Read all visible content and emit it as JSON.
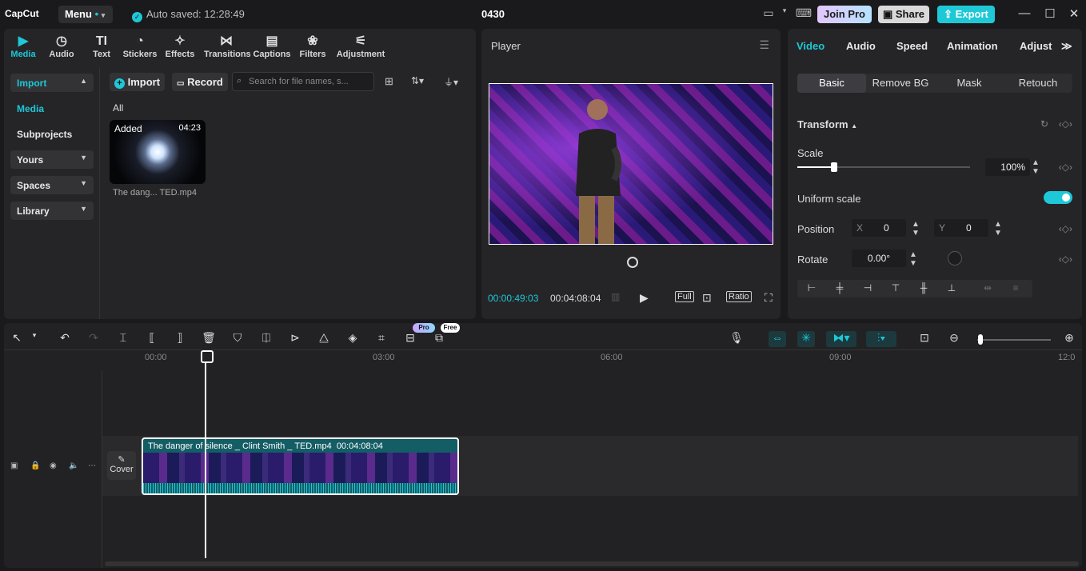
{
  "app": {
    "logo": "CapCut",
    "menu": "Menu",
    "autosave": "Auto saved: 12:28:49",
    "project_title": "0430"
  },
  "titlebar": {
    "join_pro": "Join Pro",
    "share": "Share",
    "export": "Export"
  },
  "toolbar": {
    "tabs": [
      {
        "label": "Media",
        "icon": "media-icon"
      },
      {
        "label": "Audio",
        "icon": "audio-icon"
      },
      {
        "label": "Text",
        "icon": "text-icon"
      },
      {
        "label": "Stickers",
        "icon": "stickers-icon"
      },
      {
        "label": "Effects",
        "icon": "effects-icon"
      },
      {
        "label": "Transitions",
        "icon": "transitions-icon"
      },
      {
        "label": "Captions",
        "icon": "captions-icon"
      },
      {
        "label": "Filters",
        "icon": "filters-icon"
      },
      {
        "label": "Adjustment",
        "icon": "adjustment-icon"
      }
    ],
    "active": "Media"
  },
  "sidebar": {
    "items": [
      "Import",
      "Media",
      "Subprojects",
      "Yours",
      "Spaces",
      "Library"
    ]
  },
  "media": {
    "import_btn": "Import",
    "record_btn": "Record",
    "search_placeholder": "Search for file names, s...",
    "filter_all": "All",
    "file": {
      "badge": "Added",
      "duration": "04:23",
      "name": "The dang... TED.mp4"
    }
  },
  "player": {
    "title": "Player",
    "current_time": "00:00:49:03",
    "total_time": "00:04:08:04",
    "full_btn": "Full",
    "ratio_btn": "Ratio"
  },
  "props": {
    "tabs": [
      "Video",
      "Audio",
      "Speed",
      "Animation",
      "Adjust"
    ],
    "subtabs": [
      "Basic",
      "Remove BG",
      "Mask",
      "Retouch"
    ],
    "transform_title": "Transform",
    "scale_label": "Scale",
    "scale_value": "100%",
    "uniform_scale_label": "Uniform scale",
    "position_label": "Position",
    "pos_x_label": "X",
    "pos_x": "0",
    "pos_y_label": "Y",
    "pos_y": "0",
    "rotate_label": "Rotate",
    "rotate_value": "0.00°"
  },
  "timeline": {
    "ruler": [
      "00:00",
      "03:00",
      "06:00",
      "09:00",
      "12:0"
    ],
    "pro_badge": "Pro",
    "free_badge": "Free",
    "clip_title": "The danger of silence _ Clint Smith _ TED.mp4",
    "clip_duration": "00:04:08:04",
    "cover_label": "Cover"
  },
  "colors": {
    "accent": "#1ec8d6",
    "bg": "#1a1a1c",
    "panel": "#252528"
  }
}
